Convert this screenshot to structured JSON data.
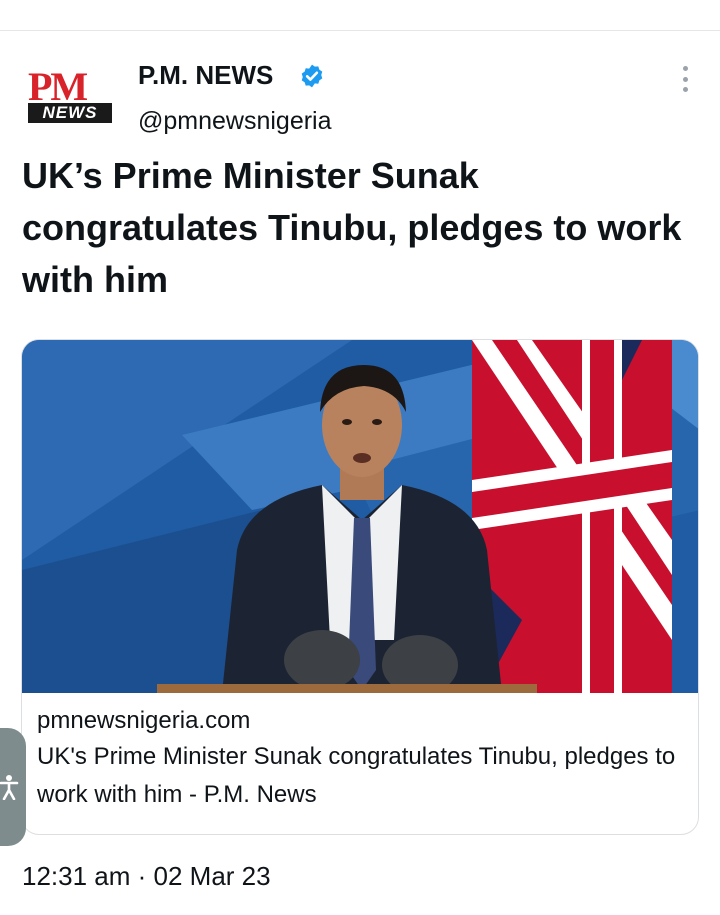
{
  "author": {
    "display_name": "P.M. NEWS",
    "handle": "@pmnewsnigeria",
    "verified": true,
    "avatar": {
      "logo_top": "PM",
      "logo_bottom": "NEWS"
    }
  },
  "tweet": {
    "text": "UK’s Prime Minister Sunak congratulates Tinubu, pledges to work with him",
    "timestamp": "12:31 am · 02 Mar 23"
  },
  "card": {
    "domain": "pmnewsnigeria.com",
    "title": "UK's Prime Minister Sunak congratulates Tinubu, pledges to work with him - P.M. News",
    "image_icon": "press-conference-photo"
  },
  "icons": {
    "more": "more-options-icon",
    "verified": "verified-badge-icon",
    "accessibility": "accessibility-icon"
  },
  "colors": {
    "verified_blue": "#1d9bf0",
    "logo_red": "#d8232a",
    "text": "#0f1419"
  }
}
